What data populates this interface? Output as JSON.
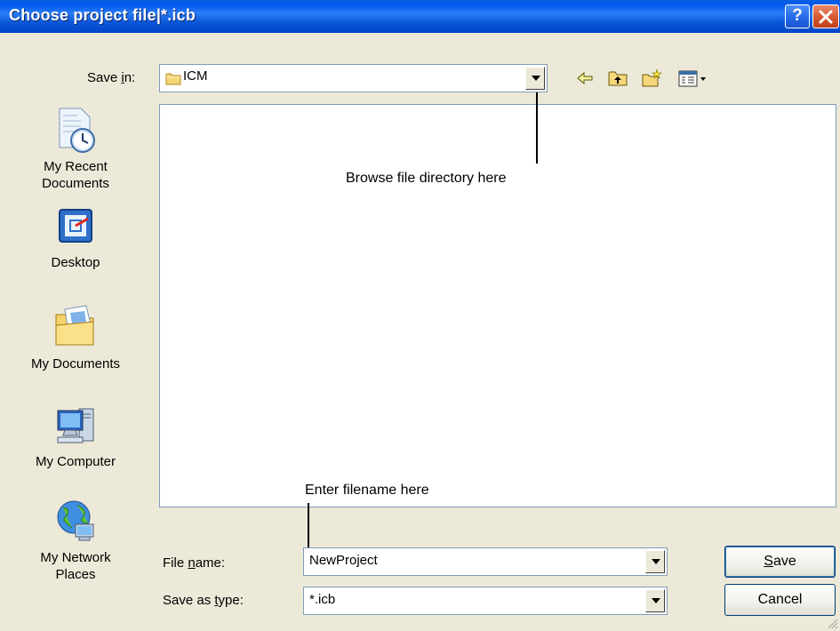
{
  "window": {
    "title": "Choose project file|*.icb"
  },
  "save_in": {
    "label_prefix": "Save ",
    "label_accel": "i",
    "label_suffix": "n:",
    "value": "ICM"
  },
  "places": [
    {
      "line1": "My Recent",
      "line2": "Documents",
      "icon": "recent-documents-icon"
    },
    {
      "line1": "Desktop",
      "line2": "",
      "icon": "desktop-icon"
    },
    {
      "line1": "My Documents",
      "line2": "",
      "icon": "my-documents-icon"
    },
    {
      "line1": "My Computer",
      "line2": "",
      "icon": "my-computer-icon"
    },
    {
      "line1": "My Network",
      "line2": "Places",
      "icon": "network-places-icon"
    }
  ],
  "annotations": {
    "browse": "Browse file directory here",
    "filename": "Enter filename here"
  },
  "file_name": {
    "label_prefix": "File ",
    "label_accel": "n",
    "label_suffix": "ame:",
    "value": "NewProject"
  },
  "save_type": {
    "label_prefix": "Save as ",
    "label_accel": "t",
    "label_suffix": "ype:",
    "value": "*.icb"
  },
  "buttons": {
    "save_accel": "S",
    "save_rest": "ave",
    "cancel": "Cancel"
  },
  "colors": {
    "titlebar": "#0058ee",
    "dialog_bg": "#ece9d8",
    "border": "#7f9db9"
  }
}
